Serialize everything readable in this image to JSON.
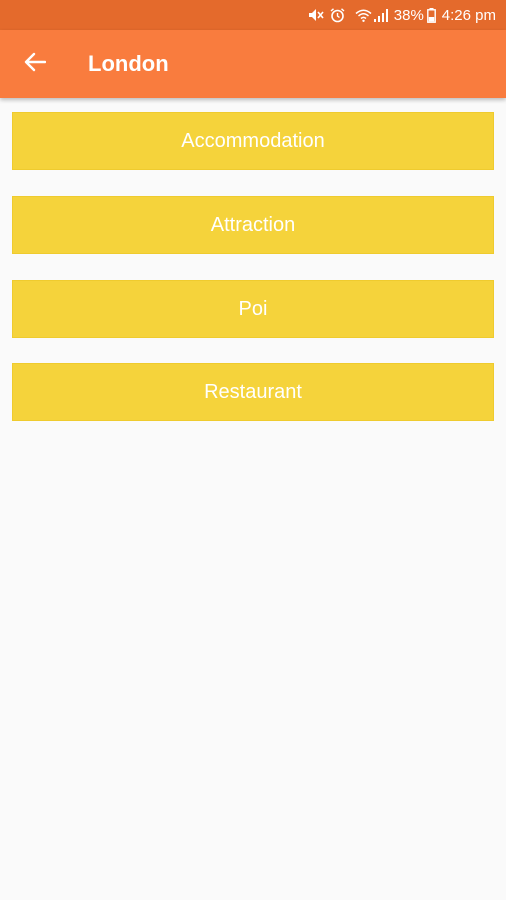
{
  "status_bar": {
    "battery": "38%",
    "time": "4:26 pm",
    "icons": [
      "mute-icon",
      "alarm-icon",
      "wifi-icon",
      "signal-icon",
      "battery-icon"
    ]
  },
  "app_bar": {
    "title": "London",
    "back_icon": "arrow-left-icon"
  },
  "categories": [
    {
      "label": "Accommodation"
    },
    {
      "label": "Attraction"
    },
    {
      "label": "Poi"
    },
    {
      "label": "Restaurant"
    }
  ],
  "colors": {
    "status_bar": "#e46a2c",
    "app_bar": "#f97c3e",
    "button": "#f5d33b",
    "background": "#fafafa"
  }
}
